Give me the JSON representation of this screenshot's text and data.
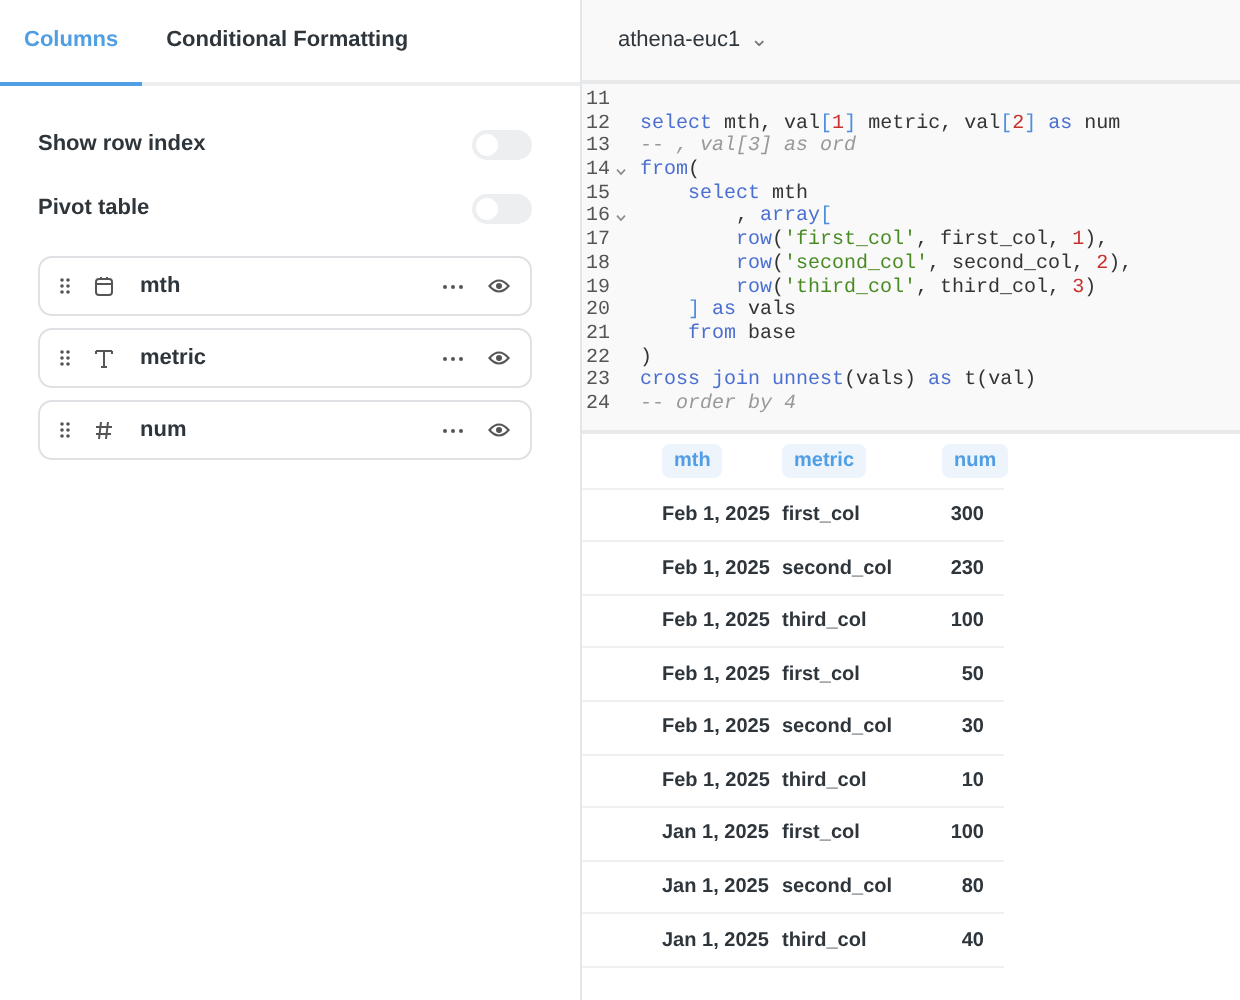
{
  "tabs": [
    {
      "label": "Columns",
      "selected": true
    },
    {
      "label": "Conditional Formatting",
      "selected": false
    }
  ],
  "settings": [
    {
      "label": "Show row index",
      "on": false
    },
    {
      "label": "Pivot table",
      "on": false
    }
  ],
  "columns": [
    {
      "name": "mth",
      "kind": "date"
    },
    {
      "name": "metric",
      "kind": "text"
    },
    {
      "name": "num",
      "kind": "number"
    }
  ],
  "database": {
    "name": "athena-euc1",
    "caret": "⌄"
  },
  "code": [
    {
      "no": "11"
    },
    {
      "no": "12",
      "segments": [
        {
          "kind": "keyword",
          "text": "select"
        },
        {
          "kind": "plain",
          "text": " mth, val"
        },
        {
          "kind": "bracket",
          "text": "["
        },
        {
          "kind": "number",
          "text": "1"
        },
        {
          "kind": "bracket",
          "text": "]"
        },
        {
          "kind": "plain",
          "text": " metric, val"
        },
        {
          "kind": "bracket",
          "text": "["
        },
        {
          "kind": "number",
          "text": "2"
        },
        {
          "kind": "bracket",
          "text": "]"
        },
        {
          "kind": "keyword",
          "text": " as"
        },
        {
          "kind": "plain",
          "text": " num"
        }
      ]
    },
    {
      "no": "13",
      "segments": [
        {
          "kind": "comment",
          "text": "-- , val[3] as ord"
        }
      ]
    },
    {
      "no": "14",
      "fold": true,
      "segments": [
        {
          "kind": "keyword",
          "text": "from"
        },
        {
          "kind": "plain",
          "text": "("
        }
      ]
    },
    {
      "no": "15",
      "segments": [
        {
          "kind": "keyword",
          "text": "    select"
        },
        {
          "kind": "plain",
          "text": " mth"
        }
      ]
    },
    {
      "no": "16",
      "fold": true,
      "segments": [
        {
          "kind": "plain",
          "text": "        ,"
        },
        {
          "kind": "keyword",
          "text": " array"
        },
        {
          "kind": "bracket",
          "text": "["
        }
      ]
    },
    {
      "no": "17",
      "segments": [
        {
          "kind": "keyword",
          "text": "        row"
        },
        {
          "kind": "plain",
          "text": "("
        },
        {
          "kind": "string",
          "text": "'first_col'"
        },
        {
          "kind": "plain",
          "text": ", first_col, "
        },
        {
          "kind": "number",
          "text": "1"
        },
        {
          "kind": "plain",
          "text": "),"
        }
      ]
    },
    {
      "no": "18",
      "segments": [
        {
          "kind": "keyword",
          "text": "        row"
        },
        {
          "kind": "plain",
          "text": "("
        },
        {
          "kind": "string",
          "text": "'second_col'"
        },
        {
          "kind": "plain",
          "text": ", second_col, "
        },
        {
          "kind": "number",
          "text": "2"
        },
        {
          "kind": "plain",
          "text": "),"
        }
      ]
    },
    {
      "no": "19",
      "segments": [
        {
          "kind": "keyword",
          "text": "        row"
        },
        {
          "kind": "plain",
          "text": "("
        },
        {
          "kind": "string",
          "text": "'third_col'"
        },
        {
          "kind": "plain",
          "text": ", third_col, "
        },
        {
          "kind": "number",
          "text": "3"
        },
        {
          "kind": "plain",
          "text": ")"
        }
      ]
    },
    {
      "no": "20",
      "segments": [
        {
          "kind": "bracket",
          "text": "    ]"
        },
        {
          "kind": "keyword",
          "text": " as"
        },
        {
          "kind": "plain",
          "text": " vals"
        }
      ]
    },
    {
      "no": "21",
      "segments": [
        {
          "kind": "keyword",
          "text": "    from"
        },
        {
          "kind": "plain",
          "text": " base"
        }
      ]
    },
    {
      "no": "22",
      "segments": [
        {
          "kind": "plain",
          "text": ")"
        }
      ]
    },
    {
      "no": "23",
      "segments": [
        {
          "kind": "keyword",
          "text": "cross join unnest"
        },
        {
          "kind": "plain",
          "text": "(vals)"
        },
        {
          "kind": "keyword",
          "text": " as"
        },
        {
          "kind": "plain",
          "text": " t(val)"
        }
      ]
    },
    {
      "no": "24",
      "segments": [
        {
          "kind": "comment",
          "text": "-- order by 4"
        }
      ]
    }
  ],
  "results": {
    "columns": [
      "mth",
      "metric",
      "num"
    ],
    "rows": [
      [
        "Feb 1, 2025",
        "first_col",
        "300"
      ],
      [
        "Feb 1, 2025",
        "second_col",
        "230"
      ],
      [
        "Feb 1, 2025",
        "third_col",
        "100"
      ],
      [
        "Feb 1, 2025",
        "first_col",
        "50"
      ],
      [
        "Feb 1, 2025",
        "second_col",
        "30"
      ],
      [
        "Feb 1, 2025",
        "third_col",
        "10"
      ],
      [
        "Jan 1, 2025",
        "first_col",
        "100"
      ],
      [
        "Jan 1, 2025",
        "second_col",
        "80"
      ],
      [
        "Jan 1, 2025",
        "third_col",
        "40"
      ]
    ]
  }
}
